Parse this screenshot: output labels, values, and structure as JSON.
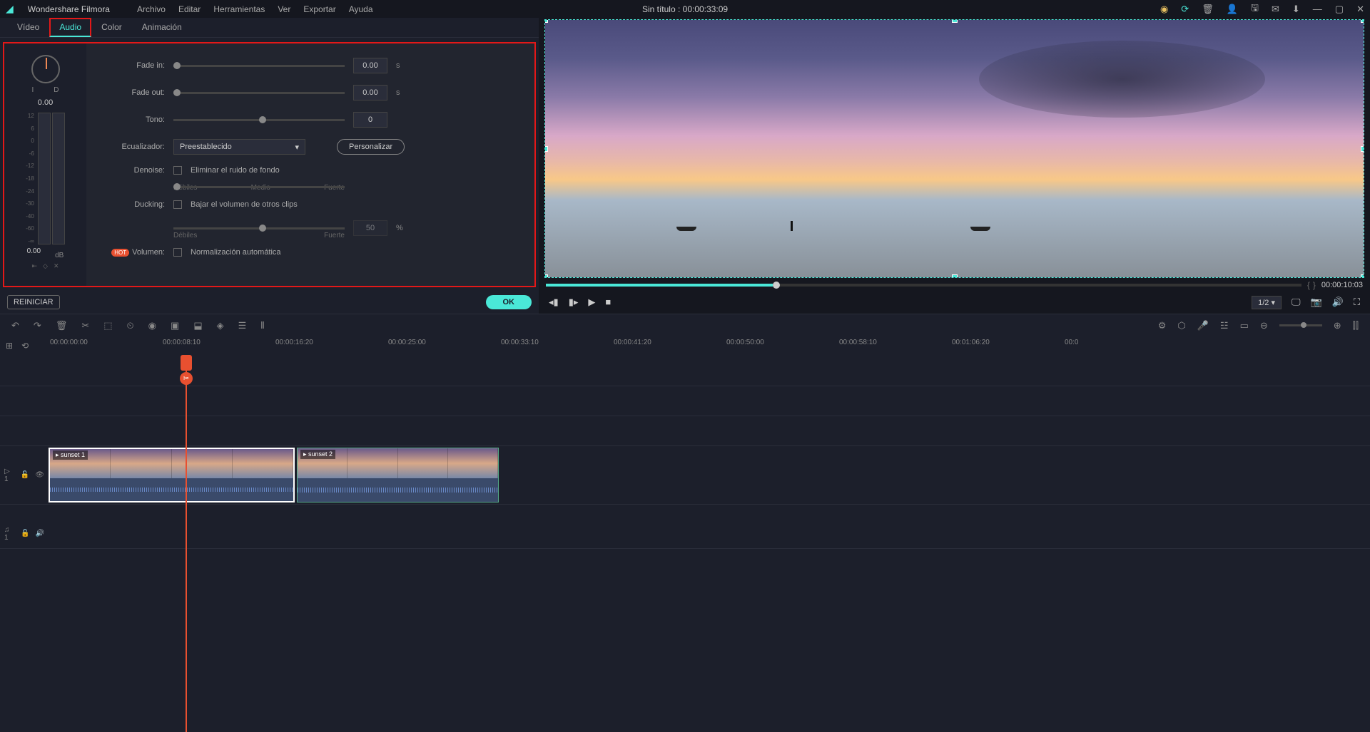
{
  "app": {
    "name": "Wondershare Filmora"
  },
  "menu": [
    "Archivo",
    "Editar",
    "Herramientas",
    "Ver",
    "Exportar",
    "Ayuda"
  ],
  "title": "Sin título : 00:00:33:09",
  "tabs": {
    "video": "Vídeo",
    "audio": "Audio",
    "color": "Color",
    "animation": "Animación"
  },
  "gauge": {
    "left": "I",
    "right": "D",
    "value": "0.00"
  },
  "vu": {
    "scale": [
      "12",
      "6",
      "0",
      "-6",
      "-12",
      "-18",
      "-24",
      "-30",
      "-40",
      "-60",
      "-∞"
    ],
    "db": "dB",
    "value": "0.00",
    "ctrls": [
      "⇤",
      "◇",
      "✕"
    ]
  },
  "audio": {
    "fade_in": {
      "label": "Fade in:",
      "value": "0.00",
      "unit": "s"
    },
    "fade_out": {
      "label": "Fade out:",
      "value": "0.00",
      "unit": "s"
    },
    "tone": {
      "label": "Tono:",
      "value": "0"
    },
    "eq": {
      "label": "Ecualizador:",
      "selected": "Preestablecido",
      "custom": "Personalizar"
    },
    "denoise": {
      "label": "Denoise:",
      "check": "Eliminar el ruido de fondo",
      "weak": "Débiles",
      "mid": "Medio",
      "strong": "Fuerte"
    },
    "ducking": {
      "label": "Ducking:",
      "check": "Bajar el volumen de otros clips",
      "value": "50",
      "unit": "%",
      "weak": "Débiles",
      "strong": "Fuerte"
    },
    "volume": {
      "label": "Volumen:",
      "hot": "HOT",
      "check": "Normalización automática"
    }
  },
  "buttons": {
    "reset": "REINICIAR",
    "ok": "OK"
  },
  "preview": {
    "time": "00:00:10:03",
    "zoom": "1/2"
  },
  "timeline": {
    "marks": [
      "00:00:00:00",
      "00:00:08:10",
      "00:00:16:20",
      "00:00:25:00",
      "00:00:33:10",
      "00:00:41:20",
      "00:00:50:00",
      "00:00:58:10",
      "00:01:06:20",
      "00:0"
    ],
    "clips": [
      {
        "name": "sunset 1"
      },
      {
        "name": "sunset 2"
      }
    ]
  },
  "track_labels": {
    "video": "▷ 1",
    "audio": "♫ 1"
  }
}
